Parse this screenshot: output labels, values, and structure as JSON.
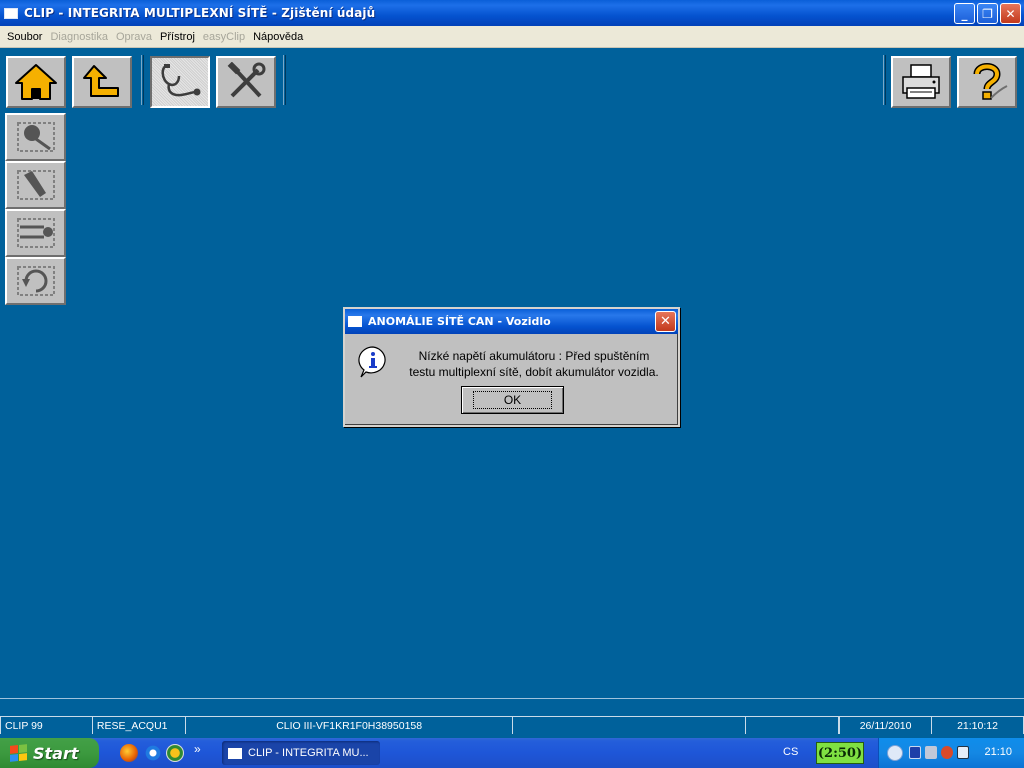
{
  "window": {
    "title": "CLIP - INTEGRITA MULTIPLEXNÍ SÍTĚ - Zjištění údajů",
    "minimize": "_",
    "restore": "❐",
    "close": "✕"
  },
  "menu": [
    {
      "label": "Soubor",
      "enabled": true
    },
    {
      "label": "Diagnostika",
      "enabled": false
    },
    {
      "label": "Oprava",
      "enabled": false
    },
    {
      "label": "Přístroj",
      "enabled": true
    },
    {
      "label": "easyClip",
      "enabled": false
    },
    {
      "label": "Nápověda",
      "enabled": true
    }
  ],
  "toolbar": {
    "home_icon": "home-icon",
    "back_icon": "back-arrow-icon",
    "diagnostic_icon": "stethoscope-icon",
    "repair_icon": "tools-icon",
    "print_icon": "printer-icon",
    "help_icon": "help-icon",
    "accent": "#f5b000"
  },
  "side_tools": [
    "network-scan-icon",
    "network-edit-icon",
    "network-connect-icon",
    "network-cycle-icon"
  ],
  "dialog": {
    "title": "ANOMÁLIE SÍTĚ CAN - Vozidlo",
    "message_line1": "Nízké napětí akumulátoru : Před spuštěním",
    "message_line2": "testu multiplexní sítě, dobít akumulátor vozidla.",
    "ok_label": "OK",
    "close": "✕"
  },
  "status": {
    "cells": [
      "CLIP 99",
      "RESE_ACQU1",
      "CLIO III-VF1KR1F0H38950158",
      "",
      "",
      "",
      "26/11/2010",
      "21:10:12"
    ]
  },
  "taskbar": {
    "start_label": "Start",
    "task_label": "CLIP - INTEGRITA MU...",
    "chevron": "»",
    "language": "CS",
    "timer": "(2:50)",
    "clock": "21:10"
  },
  "colors": {
    "desktop": "#00619b",
    "panel": "#c0c0c0"
  }
}
